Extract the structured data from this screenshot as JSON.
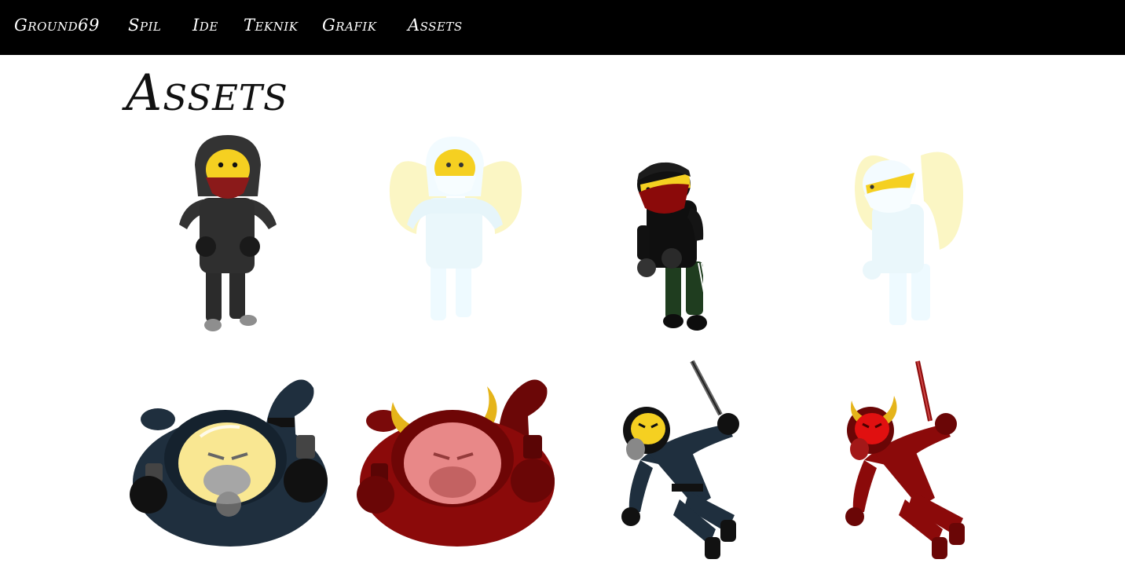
{
  "nav": {
    "brand": "Ground69",
    "links": [
      "Spil",
      "Ide",
      "Teknik",
      "Grafik",
      "Assets"
    ]
  },
  "page": {
    "title": "Assets"
  },
  "colors": {
    "nav_bg": "#000000",
    "skin": "#f5d021",
    "navy": "#1f2f3e",
    "devil_red": "#8b0a0a",
    "angel_white": "#eefaff",
    "angel_wing": "#fbf6c4",
    "gold_horn": "#e5b41a"
  },
  "assets": [
    {
      "name": "hooded-rioter",
      "icon": "hooded-rioter-icon"
    },
    {
      "name": "angel-hooded-rioter",
      "icon": "angel-hooded-rioter-icon"
    },
    {
      "name": "tracksuit-rioter",
      "icon": "tracksuit-rioter-icon"
    },
    {
      "name": "angel-tracksuit-rioter",
      "icon": "angel-tracksuit-rioter-icon"
    },
    {
      "name": "riot-police-shield",
      "icon": "riot-police-shield-icon"
    },
    {
      "name": "devil-riot-police-shield",
      "icon": "devil-riot-police-shield-icon"
    },
    {
      "name": "riot-police-baton",
      "icon": "riot-police-baton-icon"
    },
    {
      "name": "devil-riot-police-baton",
      "icon": "devil-riot-police-baton-icon"
    }
  ]
}
